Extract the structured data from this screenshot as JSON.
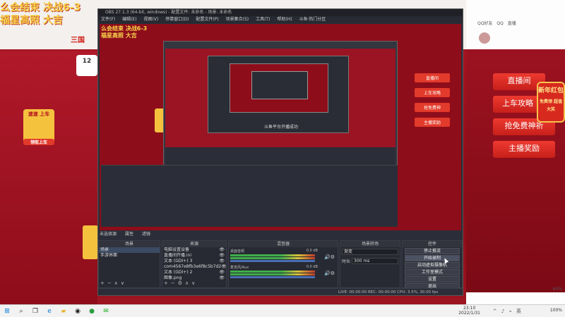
{
  "background_page": {
    "banner_line1": "么会结束 决战6-3",
    "banner_line2": "福星高照 大吉",
    "site_logo": "三国",
    "stat_number": "12",
    "stat_sub": "",
    "car_card_title": "速速 上车",
    "car_card_btn": "领取上车",
    "right_promo": {
      "zhibojian": "直播间",
      "shangche": "上车攻略",
      "qiangmianfei": "抢免费神祈",
      "zhubo": "主播奖励",
      "newyear": "新年红包",
      "newyear_sub": "免费领 超值大奖"
    },
    "right_qq": [
      "QQ好友",
      "QQ",
      "直播"
    ],
    "right_bottom": "60%"
  },
  "obs": {
    "title": "OBS 27.1.3 (64-bit, windows) - 配置文件: 未命名 - 场景: 未命名",
    "menu": [
      "文件(F)",
      "编辑(E)",
      "视图(V)",
      "停靠窗口(D)",
      "配置文件(P)",
      "场景集合(S)",
      "工具(T)",
      "帮助(H)",
      "斗鱼·热门分区"
    ],
    "preview_caption": "斗鱼平台开播成功",
    "preview_buttons": [
      "直播间",
      "上车攻略",
      "抢免费神",
      "主播奖励"
    ],
    "scene_tabs": [
      "未选择源",
      "属性",
      "滤镜"
    ],
    "docks": {
      "scenes": {
        "header": "场景",
        "items": [
          "场景",
          "手游界面"
        ]
      },
      "sources": {
        "header": "来源",
        "items": [
          "电脑设置设备",
          "直播间开播.ini",
          "文本 (GDI+) 3",
          "com4567e8fb3e6f8c5b7d2",
          "文本 (GDI+) 2",
          "图像.png"
        ]
      },
      "mixer": {
        "header": "混音器",
        "tracks": [
          {
            "label": "桌面音频",
            "db": "0.0 dB"
          },
          {
            "label": "麦克风/Aux",
            "db": "0.0 dB"
          }
        ]
      },
      "transition": {
        "header": "场景转场",
        "type": "渐变",
        "duration_label": "时长",
        "duration": "300 ms"
      },
      "controls": {
        "header": "控件",
        "buttons": [
          "停止推流",
          "开始录制",
          "启动虚拟摄像机",
          "工作室模式",
          "设置",
          "退出"
        ]
      }
    },
    "status": "LIVE: 00:00:00  REC: 00:00:00  CPU: 3.5%, 30.00 fps"
  },
  "taskbar": {
    "time": "23:10",
    "date": "2022/1/31",
    "zoom": "100%",
    "icons": [
      "windows-start",
      "search",
      "task-view",
      "edge",
      "file-explorer",
      "obs",
      "chrome",
      "wechat"
    ]
  }
}
